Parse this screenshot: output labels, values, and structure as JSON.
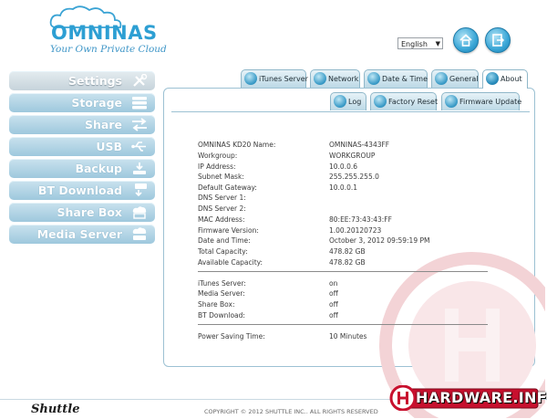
{
  "brand": {
    "name": "OMNINAS",
    "tagline": "Your Own Private Cloud",
    "vendor": "Shuttle",
    "copyright": "COPYRIGHT © 2012 SHUTTLE INC.. ALL RIGHTS RESERVED"
  },
  "header": {
    "language": "English",
    "home_icon": "home-icon",
    "logout_icon": "logout-icon"
  },
  "sidebar": {
    "items": [
      {
        "label": "Settings",
        "icon": "tools-icon",
        "active": true
      },
      {
        "label": "Storage",
        "icon": "storage-icon",
        "active": false
      },
      {
        "label": "Share",
        "icon": "share-arrows-icon",
        "active": false
      },
      {
        "label": "USB",
        "icon": "usb-icon",
        "active": false
      },
      {
        "label": "Backup",
        "icon": "backup-icon",
        "active": false
      },
      {
        "label": "BT Download",
        "icon": "bt-download-icon",
        "active": false
      },
      {
        "label": "Share Box",
        "icon": "sharebox-icon",
        "active": false
      },
      {
        "label": "Media Server",
        "icon": "media-server-icon",
        "active": false
      }
    ]
  },
  "tabs": [
    {
      "label": "iTunes Server",
      "icon": "music-note-icon"
    },
    {
      "label": "Network",
      "icon": "network-icon"
    },
    {
      "label": "Date & Time",
      "icon": "clock-icon"
    },
    {
      "label": "General",
      "icon": "general-icon"
    },
    {
      "label": "About",
      "icon": "info-icon",
      "active": true
    }
  ],
  "subtabs": [
    {
      "label": "Log",
      "icon": "log-icon"
    },
    {
      "label": "Factory Reset",
      "icon": "reset-icon"
    },
    {
      "label": "Firmware Update",
      "icon": "firmware-icon"
    }
  ],
  "info": {
    "rows": [
      {
        "label": "OMNINAS KD20 Name:",
        "value": "OMNINAS-4343FF"
      },
      {
        "label": "Workgroup:",
        "value": "WORKGROUP"
      },
      {
        "label": "IP Address:",
        "value": "10.0.0.6"
      },
      {
        "label": "Subnet Mask:",
        "value": "255.255.255.0"
      },
      {
        "label": "Default Gateway:",
        "value": "10.0.0.1"
      },
      {
        "label": "DNS Server 1:",
        "value": ""
      },
      {
        "label": "DNS Server 2:",
        "value": ""
      },
      {
        "label": "MAC Address:",
        "value": "80:EE:73:43:43:FF"
      },
      {
        "label": "Firmware Version:",
        "value": "1.00.20120723"
      },
      {
        "label": "Date and Time:",
        "value": "October 3, 2012 09:59:19 PM"
      },
      {
        "label": "Total Capacity:",
        "value": "478.82 GB"
      },
      {
        "label": "Available Capacity:",
        "value": "478.82 GB"
      }
    ],
    "services": [
      {
        "label": "iTunes Server:",
        "value": "on"
      },
      {
        "label": "Media Server:",
        "value": "off"
      },
      {
        "label": "Share Box:",
        "value": "off"
      },
      {
        "label": "BT Download:",
        "value": "off"
      }
    ],
    "power": {
      "label": "Power Saving Time:",
      "value": "10 Minutes"
    }
  },
  "watermark": {
    "text": "HARDWARE.INFO",
    "color": "#c8102e"
  }
}
